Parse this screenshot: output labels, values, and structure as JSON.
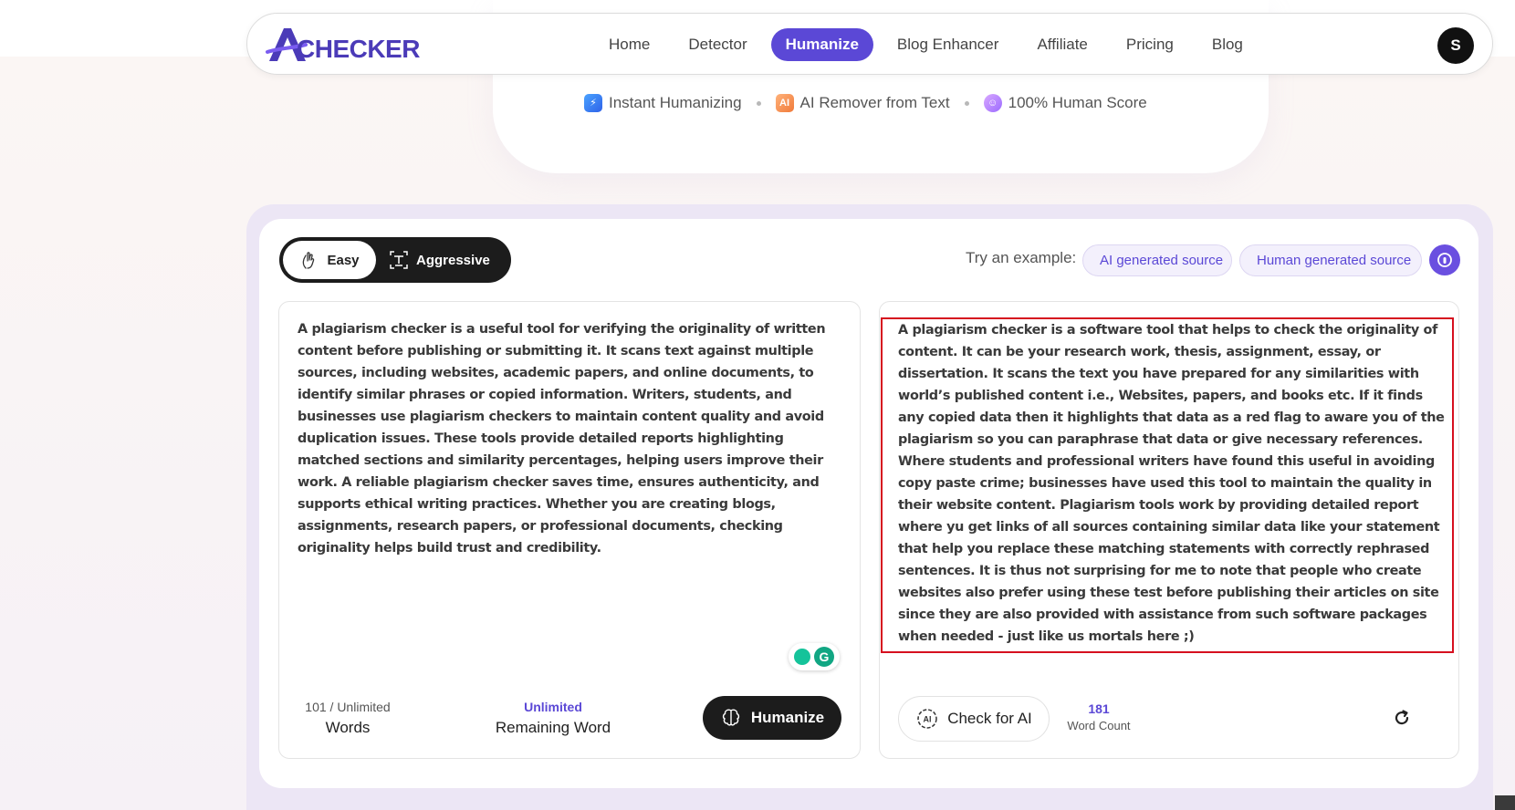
{
  "nav": {
    "logo_text": "CHECKER",
    "logo_mark": "A",
    "links": [
      "Home",
      "Detector",
      "Humanize",
      "Blog Enhancer",
      "Affiliate",
      "Pricing",
      "Blog"
    ],
    "active": "Humanize",
    "avatar_initial": "S"
  },
  "hero": {
    "features": [
      {
        "icon": "lightning-icon",
        "label": "Instant Humanizing"
      },
      {
        "icon": "ai-icon",
        "label": "AI Remover from Text"
      },
      {
        "icon": "smiley-icon",
        "label": "100% Human Score"
      }
    ]
  },
  "tool": {
    "modes": {
      "easy": "Easy",
      "aggressive": "Aggressive",
      "selected": "Easy"
    },
    "try_label": "Try an example:",
    "examples": [
      "AI generated source",
      "Human generated source"
    ],
    "input_text": "A plagiarism checker is a useful tool for verifying the originality of written content before publishing or submitting it. It scans text against multiple sources, including websites, academic papers, and online documents, to identify similar phrases or copied information. Writers, students, and businesses use plagiarism checkers to maintain content quality and avoid duplication issues. These tools provide detailed reports highlighting matched sections and similarity percentages, helping users improve their work. A reliable plagiarism checker saves time, ensures authenticity, and supports ethical writing practices. Whether you are creating blogs, assignments, research papers, or professional documents, checking originality helps build trust and credibility.",
    "output_text": "A plagiarism checker is a software tool that helps to check the originality of content. It can be your research work, thesis, assignment, essay, or dissertation. It scans the text you have prepared for any similarities with world’s published content i.e., Websites, papers, and books etc. If it finds any copied data then it highlights that data as a red flag to aware you of the plagiarism so you can paraphrase that data or give necessary references. Where students and professional writers have found this useful in avoiding copy paste crime; businesses have used this tool to maintain the quality in their website content. Plagiarism tools work by providing detailed report where yu get links of all sources containing similar data like your statement that help you replace these matching statements with correctly rephrased sentences. It is thus not surprising for me to note that people who create websites also prefer using these test before publishing their articles on site since they are also provided with assistance from such software packages when needed - just like us mortals here ;)",
    "word_stat": {
      "count": "101 / Unlimited",
      "label": "Words"
    },
    "remaining_stat": {
      "value": "Unlimited",
      "label": "Remaining Word"
    },
    "humanize_label": "Humanize",
    "check_label": "Check for AI",
    "output_word_count": {
      "value": "181",
      "label": "Word Count"
    },
    "colors": {
      "accent": "#5b48d6",
      "highlight_border": "#d6101f",
      "dark": "#1c1c1c"
    }
  }
}
